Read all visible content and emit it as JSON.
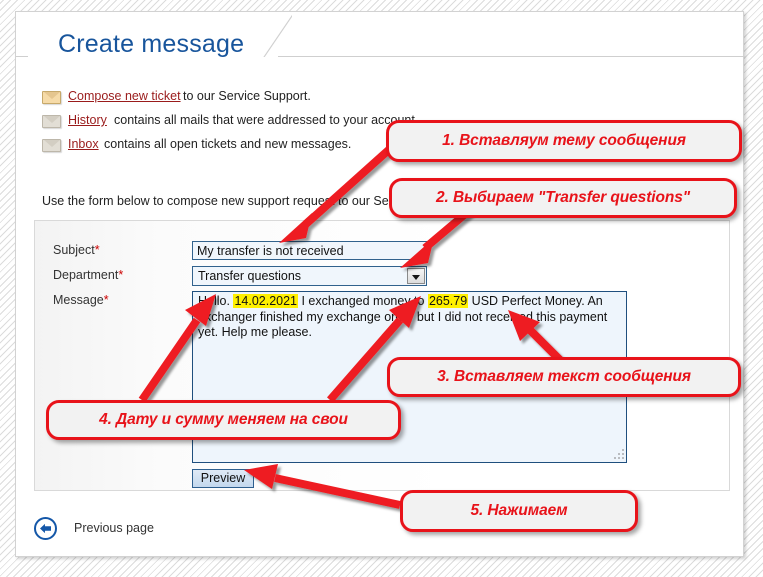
{
  "page": {
    "tab_title": "Create message"
  },
  "links": [
    {
      "icon": "envelope-icon",
      "link": "Compose new ticket",
      "rest": "to our Service Support."
    },
    {
      "icon": "envelope-icon",
      "link": "History",
      "rest": "contains all mails that were addressed to your account."
    },
    {
      "icon": "envelope-icon",
      "link": "Inbox",
      "rest": "contains all open tickets and new messages."
    }
  ],
  "intro_text": "Use the form below to compose new support request to our Service",
  "form": {
    "subject": {
      "label": "Subject",
      "required_marker": "*",
      "value": "My transfer is not received"
    },
    "department": {
      "label": "Department",
      "required_marker": "*",
      "value": "Transfer questions"
    },
    "message": {
      "label": "Message",
      "required_marker": "*",
      "part1": "Hello. ",
      "date_highlight": "14.02.2021",
      "part2": " I exchanged money to ",
      "amount_highlight": "265.79",
      "part3": " USD Perfect Money. An exchanger finished my exchange order but I did not received this payment yet. Help me please."
    },
    "preview_button": "Preview"
  },
  "footer": {
    "previous_page": "Previous page",
    "back_icon": "back-arrow-circle-icon"
  },
  "annotations": [
    {
      "id": "1",
      "text": "1. Вставляум тему сообщения"
    },
    {
      "id": "2",
      "text": "2. Выбираем \"Transfer questions\""
    },
    {
      "id": "3",
      "text": "3. Вставляем текст сообщения"
    },
    {
      "id": "4",
      "text": "4. Дату и сумму меняем на свои"
    },
    {
      "id": "5",
      "text": "5. Нажимаем"
    }
  ],
  "colors": {
    "annotation_red": "#e8131a",
    "tab_blue": "#18559c",
    "link_red": "#9a1b1b",
    "highlight_yellow": "#fff000",
    "field_border_blue": "#31628d",
    "field_background": "#f0f6fc"
  }
}
